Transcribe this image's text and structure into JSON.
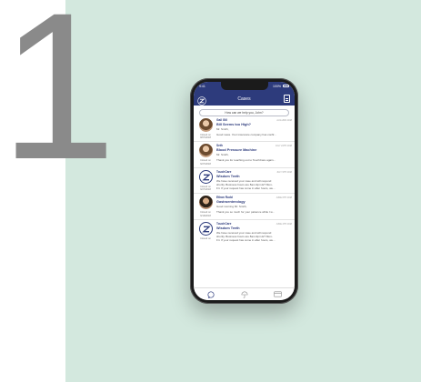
{
  "step_number": "1",
  "colors": {
    "brand": "#2d3b7c",
    "panel": "#d3e8de",
    "step": "#8a8a8a"
  },
  "status_bar": {
    "time": "9:41",
    "battery": "100%"
  },
  "header": {
    "title": "Cases"
  },
  "search": {
    "label": "How can we help you, John?"
  },
  "cases": [
    {
      "name": "Gail Gill",
      "date": "AUG 2ND 2018",
      "subject": "Bill Seems too High?",
      "lines": [
        "Mr. Smith,"
      ],
      "preview": "Good news. Your insurance company has confir...",
      "closed": [
        "Closed on",
        "8/07/2018"
      ],
      "avatar": "photo"
    },
    {
      "name": "Seth",
      "date": "JULY 24TH 2018",
      "subject": "Blood Pressure Machine",
      "lines": [
        "Mr. Smith,"
      ],
      "preview": "Thank you for reaching out to TouchCare again...",
      "closed": [
        "Closed on",
        "6/27/2018"
      ],
      "avatar": "photo"
    },
    {
      "name": "TouchCare",
      "date": "JULY 9TH 2018",
      "subject": "Wisdom Teeth",
      "lines": [
        "We have received your case and will respond",
        "shortly. Business hours are 8am-9pm ET Mon-",
        "Fri. If your request has come in after hours, we..."
      ],
      "preview": "",
      "closed": [
        "Closed on",
        "6/27/2018"
      ],
      "avatar": "logo"
    },
    {
      "name": "Ethan Rudd",
      "date": "JUNE 6TH 2018",
      "subject": "Gastroenterology",
      "lines": [
        "Good morning Mr. Smith,"
      ],
      "preview": "Thank you so much for your patience while I w...",
      "closed": [
        "Closed on",
        "6/19/2018"
      ],
      "avatar": "photo2"
    },
    {
      "name": "TouchCare",
      "date": "JUNE 4TH 2018",
      "subject": "Wisdom Teeth",
      "lines": [
        "We have received your case and will respond",
        "shortly. Business hours are 8am-9pm ET Mon-",
        "Fri. If your request has come in after hours, we..."
      ],
      "preview": "",
      "closed": [
        "Closed on",
        ""
      ],
      "avatar": "logo"
    }
  ],
  "tabbar": {
    "icons": [
      "chat-icon",
      "umbrella-icon",
      "card-icon"
    ]
  }
}
